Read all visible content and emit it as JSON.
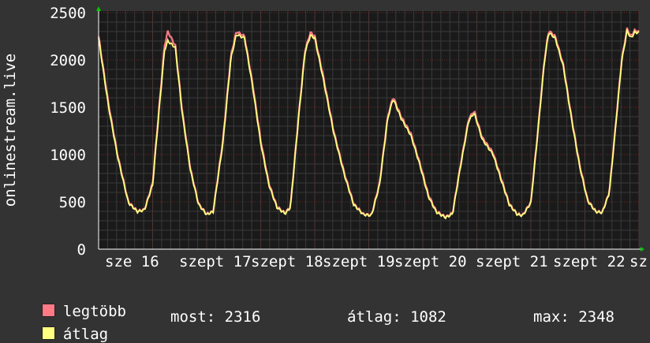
{
  "chart_data": {
    "type": "line",
    "ylabel": "onlinestream.live",
    "ylim": [
      0,
      2500
    ],
    "yticks": [
      0,
      500,
      1000,
      1500,
      2000,
      2500
    ],
    "x_tick_labels": [
      "sze 16",
      "szept 17",
      "szept 18",
      "szept 19",
      "szept 20",
      "szept 21",
      "szept 22",
      "sz"
    ],
    "grid": true,
    "colors": {
      "background": "#333333",
      "plot_bg": "#1a1a1a",
      "grid_major": "#6e2a2a",
      "grid_minor": "#3a3a3a",
      "max_series": "#ff7a85",
      "avg_series": "#ffff80",
      "axis_arrow": "#00cc00"
    },
    "series": [
      {
        "name": "legtöbb",
        "color": "#ff7a85",
        "keypoints": [
          [
            0,
            2250
          ],
          [
            0.18,
            1550
          ],
          [
            0.35,
            1000
          ],
          [
            0.55,
            500
          ],
          [
            0.72,
            400
          ],
          [
            0.85,
            420
          ],
          [
            1.0,
            700
          ],
          [
            1.12,
            1500
          ],
          [
            1.22,
            2150
          ],
          [
            1.28,
            2300
          ],
          [
            1.42,
            2150
          ],
          [
            1.55,
            1450
          ],
          [
            1.7,
            850
          ],
          [
            1.85,
            480
          ],
          [
            2.0,
            370
          ],
          [
            2.12,
            400
          ],
          [
            2.3,
            1150
          ],
          [
            2.45,
            2050
          ],
          [
            2.55,
            2300
          ],
          [
            2.7,
            2250
          ],
          [
            2.85,
            1750
          ],
          [
            3.0,
            1150
          ],
          [
            3.15,
            700
          ],
          [
            3.3,
            450
          ],
          [
            3.45,
            380
          ],
          [
            3.55,
            450
          ],
          [
            3.7,
            1400
          ],
          [
            3.82,
            2100
          ],
          [
            3.92,
            2290
          ],
          [
            4.0,
            2250
          ],
          [
            4.15,
            1850
          ],
          [
            4.35,
            1250
          ],
          [
            4.55,
            800
          ],
          [
            4.72,
            480
          ],
          [
            4.9,
            370
          ],
          [
            5.05,
            360
          ],
          [
            5.2,
            700
          ],
          [
            5.35,
            1400
          ],
          [
            5.45,
            1610
          ],
          [
            5.6,
            1400
          ],
          [
            5.78,
            1220
          ],
          [
            5.95,
            900
          ],
          [
            6.1,
            580
          ],
          [
            6.25,
            400
          ],
          [
            6.42,
            340
          ],
          [
            6.55,
            380
          ],
          [
            6.7,
            900
          ],
          [
            6.85,
            1380
          ],
          [
            6.95,
            1460
          ],
          [
            7.1,
            1180
          ],
          [
            7.3,
            1020
          ],
          [
            7.45,
            750
          ],
          [
            7.6,
            480
          ],
          [
            7.75,
            370
          ],
          [
            7.85,
            360
          ],
          [
            8.0,
            500
          ],
          [
            8.12,
            1200
          ],
          [
            8.25,
            2000
          ],
          [
            8.33,
            2310
          ],
          [
            8.45,
            2250
          ],
          [
            8.6,
            1950
          ],
          [
            8.75,
            1400
          ],
          [
            8.9,
            900
          ],
          [
            9.05,
            520
          ],
          [
            9.2,
            400
          ],
          [
            9.32,
            390
          ],
          [
            9.45,
            600
          ],
          [
            9.55,
            1200
          ],
          [
            9.68,
            2000
          ],
          [
            9.78,
            2330
          ],
          [
            9.85,
            2250
          ],
          [
            9.92,
            2310
          ],
          [
            10.0,
            2300
          ]
        ]
      },
      {
        "name": "átlag",
        "color": "#ffff80",
        "keypoints": [
          [
            0,
            2230
          ],
          [
            0.18,
            1520
          ],
          [
            0.35,
            980
          ],
          [
            0.55,
            490
          ],
          [
            0.72,
            395
          ],
          [
            0.85,
            415
          ],
          [
            1.0,
            680
          ],
          [
            1.12,
            1470
          ],
          [
            1.22,
            2100
          ],
          [
            1.28,
            2200
          ],
          [
            1.42,
            2130
          ],
          [
            1.55,
            1420
          ],
          [
            1.7,
            830
          ],
          [
            1.85,
            470
          ],
          [
            2.0,
            365
          ],
          [
            2.12,
            395
          ],
          [
            2.3,
            1120
          ],
          [
            2.45,
            2020
          ],
          [
            2.55,
            2270
          ],
          [
            2.7,
            2230
          ],
          [
            2.85,
            1720
          ],
          [
            3.0,
            1120
          ],
          [
            3.15,
            680
          ],
          [
            3.3,
            440
          ],
          [
            3.45,
            375
          ],
          [
            3.55,
            440
          ],
          [
            3.7,
            1380
          ],
          [
            3.82,
            2080
          ],
          [
            3.92,
            2260
          ],
          [
            4.0,
            2230
          ],
          [
            4.15,
            1820
          ],
          [
            4.35,
            1230
          ],
          [
            4.55,
            780
          ],
          [
            4.72,
            470
          ],
          [
            4.9,
            365
          ],
          [
            5.05,
            355
          ],
          [
            5.2,
            680
          ],
          [
            5.35,
            1380
          ],
          [
            5.45,
            1590
          ],
          [
            5.6,
            1380
          ],
          [
            5.78,
            1200
          ],
          [
            5.95,
            880
          ],
          [
            6.1,
            560
          ],
          [
            6.25,
            390
          ],
          [
            6.42,
            335
          ],
          [
            6.55,
            370
          ],
          [
            6.7,
            880
          ],
          [
            6.85,
            1360
          ],
          [
            6.95,
            1440
          ],
          [
            7.1,
            1160
          ],
          [
            7.3,
            1000
          ],
          [
            7.45,
            730
          ],
          [
            7.6,
            470
          ],
          [
            7.75,
            365
          ],
          [
            7.85,
            355
          ],
          [
            8.0,
            490
          ],
          [
            8.12,
            1180
          ],
          [
            8.25,
            1980
          ],
          [
            8.33,
            2290
          ],
          [
            8.45,
            2230
          ],
          [
            8.6,
            1930
          ],
          [
            8.75,
            1380
          ],
          [
            8.9,
            880
          ],
          [
            9.05,
            510
          ],
          [
            9.2,
            395
          ],
          [
            9.32,
            385
          ],
          [
            9.45,
            590
          ],
          [
            9.55,
            1180
          ],
          [
            9.68,
            1980
          ],
          [
            9.78,
            2310
          ],
          [
            9.85,
            2230
          ],
          [
            9.92,
            2290
          ],
          [
            10.0,
            2290
          ]
        ]
      }
    ]
  },
  "legend": {
    "max_label": "legtöbb",
    "avg_label": "átlag"
  },
  "stats": {
    "current": "most: 2316",
    "average": "átlag: 1082",
    "maximum": "max: 2348"
  }
}
